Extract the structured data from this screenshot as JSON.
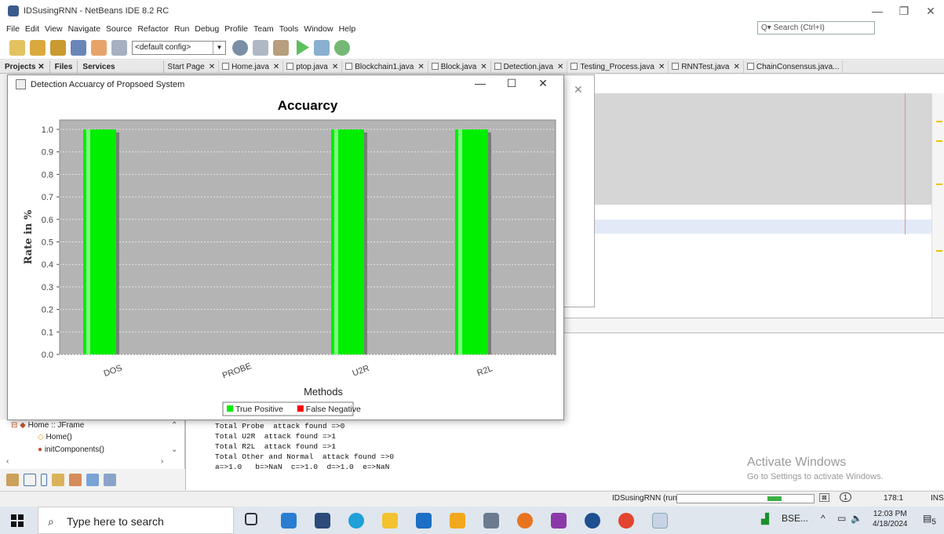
{
  "window": {
    "title": "IDSusingRNN - NetBeans IDE 8.2 RC",
    "controls": [
      "—",
      "❐",
      "✕"
    ]
  },
  "menu": [
    "File",
    "Edit",
    "View",
    "Navigate",
    "Source",
    "Refactor",
    "Run",
    "Debug",
    "Profile",
    "Team",
    "Tools",
    "Window",
    "Help"
  ],
  "search": {
    "placeholder": "Search (Ctrl+I)"
  },
  "toolbar": {
    "config": "<default config>"
  },
  "panel_tabs": [
    {
      "label": "Projects ✕"
    },
    {
      "label": "Files"
    },
    {
      "label": "Services"
    }
  ],
  "editor_tabs": [
    {
      "label": "Start Page"
    },
    {
      "label": "Home.java"
    },
    {
      "label": "ptop.java"
    },
    {
      "label": "Blockchain1.java"
    },
    {
      "label": "Block.java"
    },
    {
      "label": "Detection.java"
    },
    {
      "label": "Testing_Process.java"
    },
    {
      "label": "RNNTest.java"
    },
    {
      "label": "ChainConsensus.java..."
    }
  ],
  "chart_window": {
    "title": "Detection Accuarcy of Propsoed System",
    "controls": [
      "—",
      "☐",
      "✕"
    ]
  },
  "chart_data": {
    "type": "bar",
    "title": "Accuarcy",
    "xlabel": "Methods",
    "ylabel": "Rate in %",
    "categories": [
      "DOS",
      "PROBE",
      "U2R",
      "R2L"
    ],
    "ylim": [
      0.0,
      1.0
    ],
    "yticks": [
      "0.0",
      "0.1",
      "0.2",
      "0.3",
      "0.4",
      "0.5",
      "0.6",
      "0.7",
      "0.8",
      "0.9",
      "1.0"
    ],
    "series": [
      {
        "name": "True Positive",
        "color": "#00ee00",
        "values": [
          1.0,
          0.0,
          1.0,
          1.0
        ]
      },
      {
        "name": "False Negative",
        "color": "#ff0000",
        "values": [
          0.0,
          0.0,
          0.0,
          0.0
        ]
      }
    ],
    "grid": true,
    "legend": "bottom",
    "plot_background": "#b4b4b4"
  },
  "navigator": {
    "root": "Home :: JFrame",
    "items": [
      "Home()",
      "initComponents()"
    ]
  },
  "output_lines": [
    "Total Probe  attack found =>0",
    "Total U2R  attack found =>1",
    "Total R2L  attack found =>1",
    "Total Other and Normal  attack found =>0",
    "a=>1.0   b=>NaN  c=>1.0  d=>1.0  e=>NaN"
  ],
  "watermark": {
    "line1": "Activate Windows",
    "line2": "Go to Settings to activate Windows."
  },
  "status": {
    "run": "IDSusingRNN (run)",
    "position": "178:1",
    "mode": "INS",
    "notification_count": "1"
  },
  "taskbar": {
    "search_placeholder": "Type here to search",
    "tray_app": "BSE...",
    "time": "12:03 PM",
    "date": "4/18/2024",
    "notifications": "5"
  }
}
